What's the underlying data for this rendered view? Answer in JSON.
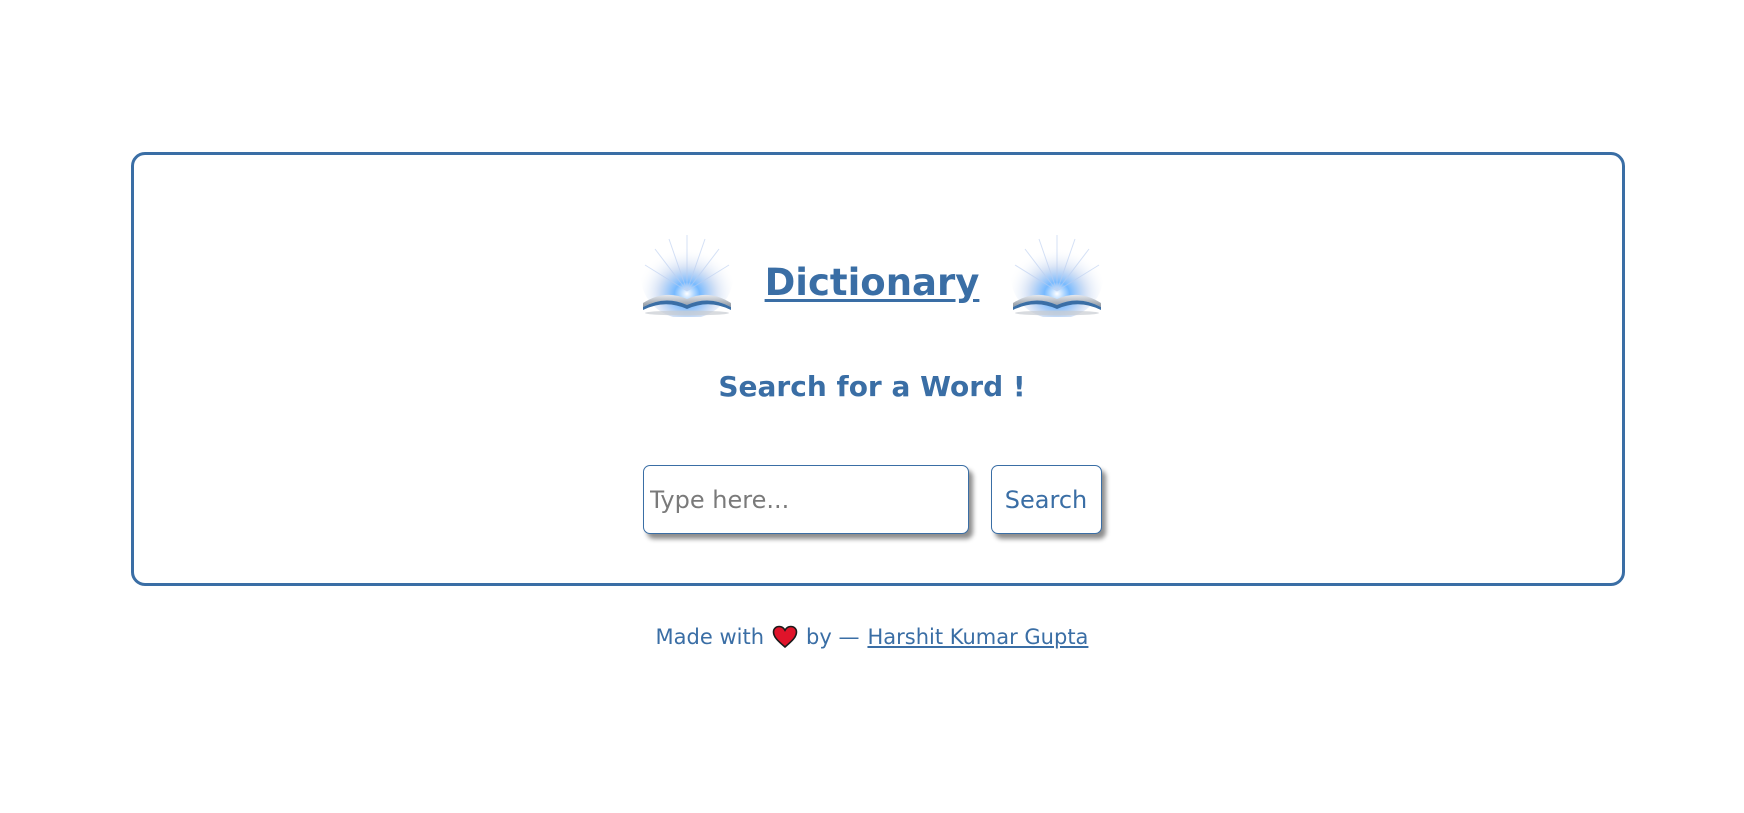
{
  "header": {
    "title": "Dictionary",
    "subtitle": "Search for a Word !",
    "icon_left": "open-book-glow-icon",
    "icon_right": "open-book-glow-icon"
  },
  "search": {
    "placeholder": "Type here...",
    "value": "",
    "button_label": "Search"
  },
  "footer": {
    "made_with": "Made with",
    "heart_icon": "heart-icon",
    "by_text": "by —",
    "author": "Harshit Kumar Gupta"
  },
  "colors": {
    "accent": "#3a6ea5",
    "heart": "#e0142a",
    "background": "#ffffff"
  }
}
